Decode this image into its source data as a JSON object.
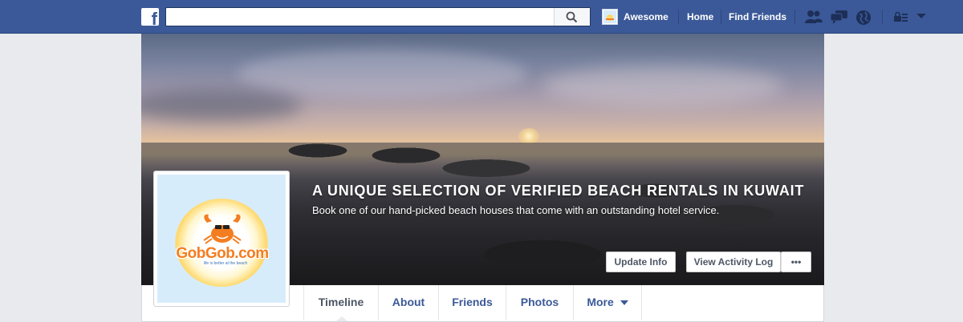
{
  "topbar": {
    "logo_letter": "f",
    "search_placeholder": "",
    "user_name": "Awesome",
    "nav_home": "Home",
    "nav_find_friends": "Find Friends",
    "icons": [
      "friend-requests-icon",
      "messages-icon",
      "notifications-globe-icon",
      "privacy-lock-icon",
      "account-menu-chevron-icon"
    ],
    "bar_color": "#3b5998"
  },
  "cover": {
    "title": "A UNIQUE SELECTION OF VERIFIED BEACH RENTALS IN KUWAIT",
    "subtitle": "Book one of our hand-picked beach houses that come with an outstanding hotel service.",
    "update_info_label": "Update Info",
    "activity_log_label": "View Activity Log",
    "more_label": "•••"
  },
  "profile": {
    "logo_text": "GobGob.com",
    "logo_tagline": "life is better at the beach",
    "logo_color": "#f47d20"
  },
  "tabs": {
    "timeline": "Timeline",
    "about": "About",
    "friends": "Friends",
    "photos": "Photos",
    "more": "More"
  }
}
